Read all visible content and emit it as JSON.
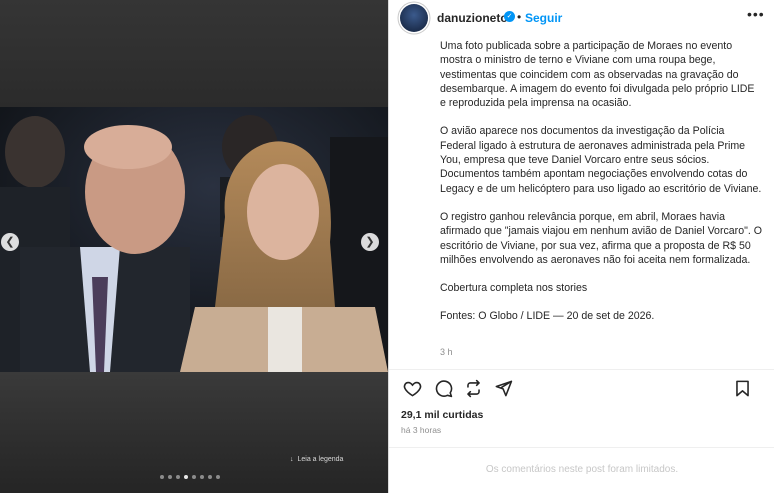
{
  "post": {
    "username": "danuzioneto",
    "separator": "•",
    "follow_label": "Seguir",
    "more_icon": "more-options-icon",
    "caption": [
      "Uma foto publicada sobre a participação de Moraes no evento mostra o ministro de terno e Viviane com uma roupa bege, vestimentas que coincidem com as observadas na gravação do desembarque. A imagem do evento foi divulgada pelo próprio LIDE e reproduzida pela imprensa na ocasião.",
      "O avião aparece nos documentos da investigação da Polícia Federal ligado à estrutura de aeronaves administrada pela Prime You, empresa que teve Daniel Vorcaro entre seus sócios. Documentos também apontam negociações envolvendo cotas do Legacy e de um helicóptero para uso ligado ao escritório de Viviane.",
      "O registro ganhou relevância porque, em abril, Moraes havia afirmado que \"jamais viajou em nenhum avião de Daniel Vorcaro\". O escritório de Viviane, por sua vez, afirma que a proposta de R$ 50 milhões envolvendo as aeronaves não foi aceita nem formalizada.",
      "Cobertura completa nos stories",
      "Fontes: O Globo / LIDE — 20 de set de 2026."
    ],
    "caption_time": "3 h",
    "likes": "29,1 mil curtidas",
    "posted_ago": "há 3 horas",
    "comments_limited": "Os comentários neste post foram limitados."
  },
  "media": {
    "legend_link": "Leia a legenda",
    "carousel_count": 8,
    "carousel_active": 4
  },
  "colors": {
    "accent": "#0095f6",
    "text": "#262626",
    "muted": "#8e8e8e"
  }
}
